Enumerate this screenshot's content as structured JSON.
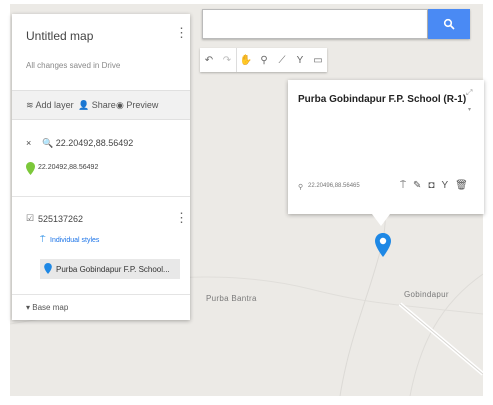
{
  "panel": {
    "title": "Untitled map",
    "saved_status": "All changes saved in Drive",
    "actions": {
      "add_layer": "Add layer",
      "share": "Share",
      "preview": "Preview"
    },
    "search_result": {
      "query": "22.20492,88.56492",
      "result": "22.20492,88.56492"
    },
    "layer": {
      "name": "525137262",
      "style": "Individual styles",
      "item": "Purba Gobindapur F.P. School..."
    },
    "base_map": "Base map"
  },
  "search": {
    "value": "",
    "placeholder": ""
  },
  "infowindow": {
    "title": "Purba Gobindapur F.P. School (R-1)",
    "coordinates": "22.20496,88.56465"
  },
  "map_labels": {
    "place1": "Purba Bantra",
    "place2": "Gobindapur"
  },
  "icons": {
    "search": "search-icon",
    "undo": "undo-icon",
    "redo": "redo-icon",
    "pan": "hand-icon",
    "marker": "marker-icon",
    "line": "line-icon",
    "directions": "directions-icon",
    "measure": "ruler-icon",
    "pin": "map-pin-icon"
  },
  "colors": {
    "accent": "#4a8af4",
    "marker_green": "#7cc83a",
    "marker_blue": "#1e88e5"
  }
}
